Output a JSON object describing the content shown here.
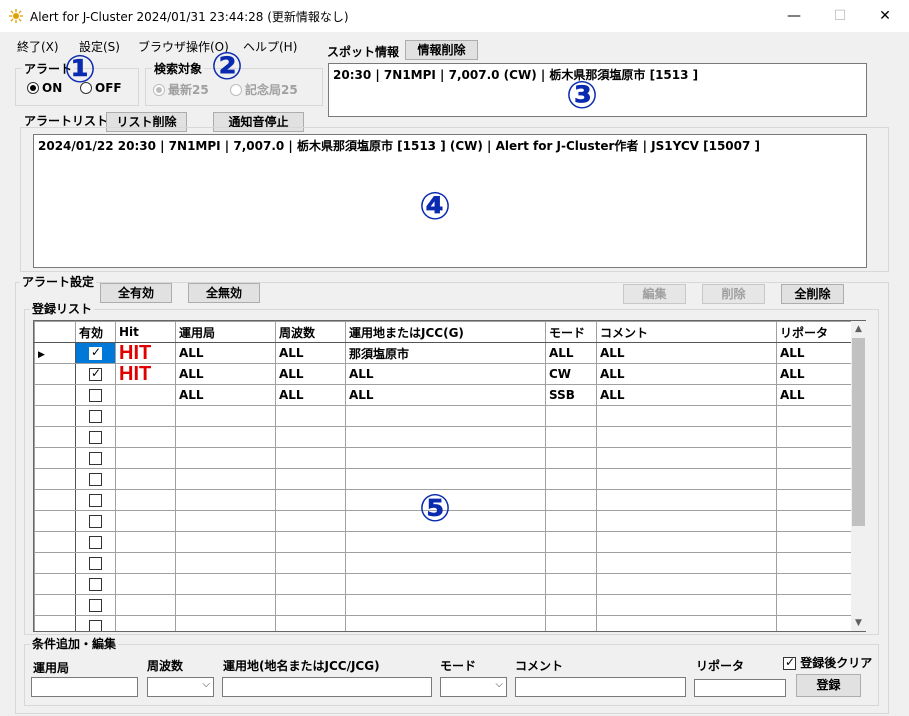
{
  "window": {
    "title": "Alert for J-Cluster  2024/01/31 23:44:28 (更新情報なし)",
    "minimize": "—",
    "maximize": "☐",
    "close": "✕"
  },
  "menu": [
    {
      "label": "終了(X)"
    },
    {
      "label": "設定(S)"
    },
    {
      "label": "ブラウザ操作(O)"
    },
    {
      "label": "ヘルプ(H)"
    }
  ],
  "alert_group": {
    "label": "アラート",
    "on": "ON",
    "off": "OFF",
    "selected": "ON"
  },
  "search_group": {
    "label": "検索対象",
    "latest": "最新25",
    "memorial": "記念局25",
    "selected": "最新25"
  },
  "spot": {
    "label": "スポット情報",
    "clear_button": "情報削除",
    "text": "20:30 | 7N1MPI | 7,007.0 (CW) | 栃木県那須塩原市 [1513 ]"
  },
  "alert_list": {
    "label": "アラートリスト",
    "clear_button": "リスト削除",
    "stop_sound_button": "通知音停止",
    "text": "2024/01/22 20:30 | 7N1MPI | 7,007.0 | 栃木県那須塩原市 [1513 ] (CW) | Alert for J-Cluster作者 | JS1YCV [15007 ]"
  },
  "alert_settings": {
    "label": "アラート設定",
    "all_enable": "全有効",
    "all_disable": "全無効",
    "edit": "編集",
    "delete": "削除",
    "delete_all": "全削除",
    "registration_label": "登録リスト"
  },
  "table": {
    "columns": [
      "有効",
      "Hit",
      "運用局",
      "周波数",
      "運用地またはJCC(G)",
      "モード",
      "コメント",
      "リポータ"
    ],
    "rows": [
      {
        "enabled": true,
        "hit": "HIT",
        "station": "ALL",
        "freq": "ALL",
        "location": "那須塩原市",
        "mode": "ALL",
        "comment": "ALL",
        "reporter": "ALL"
      },
      {
        "enabled": true,
        "hit": "HIT",
        "station": "ALL",
        "freq": "ALL",
        "location": "ALL",
        "mode": "CW",
        "comment": "ALL",
        "reporter": "ALL"
      },
      {
        "enabled": false,
        "hit": "",
        "station": "ALL",
        "freq": "ALL",
        "location": "ALL",
        "mode": "SSB",
        "comment": "ALL",
        "reporter": "ALL"
      }
    ],
    "empty_rows": 12
  },
  "edit_group": {
    "label": "条件追加・編集",
    "station": "運用局",
    "freq": "周波数",
    "location": "運用地(地名またはJCC/JCG)",
    "mode": "モード",
    "comment": "コメント",
    "reporter": "リポータ",
    "clear_after": "登録後クリア",
    "register": "登録"
  },
  "callouts": [
    "①",
    "②",
    "③",
    "④",
    "⑤"
  ],
  "colors": {
    "callout": "#0a2bb0",
    "hit": "#e00000",
    "selection": "#0078d7"
  }
}
